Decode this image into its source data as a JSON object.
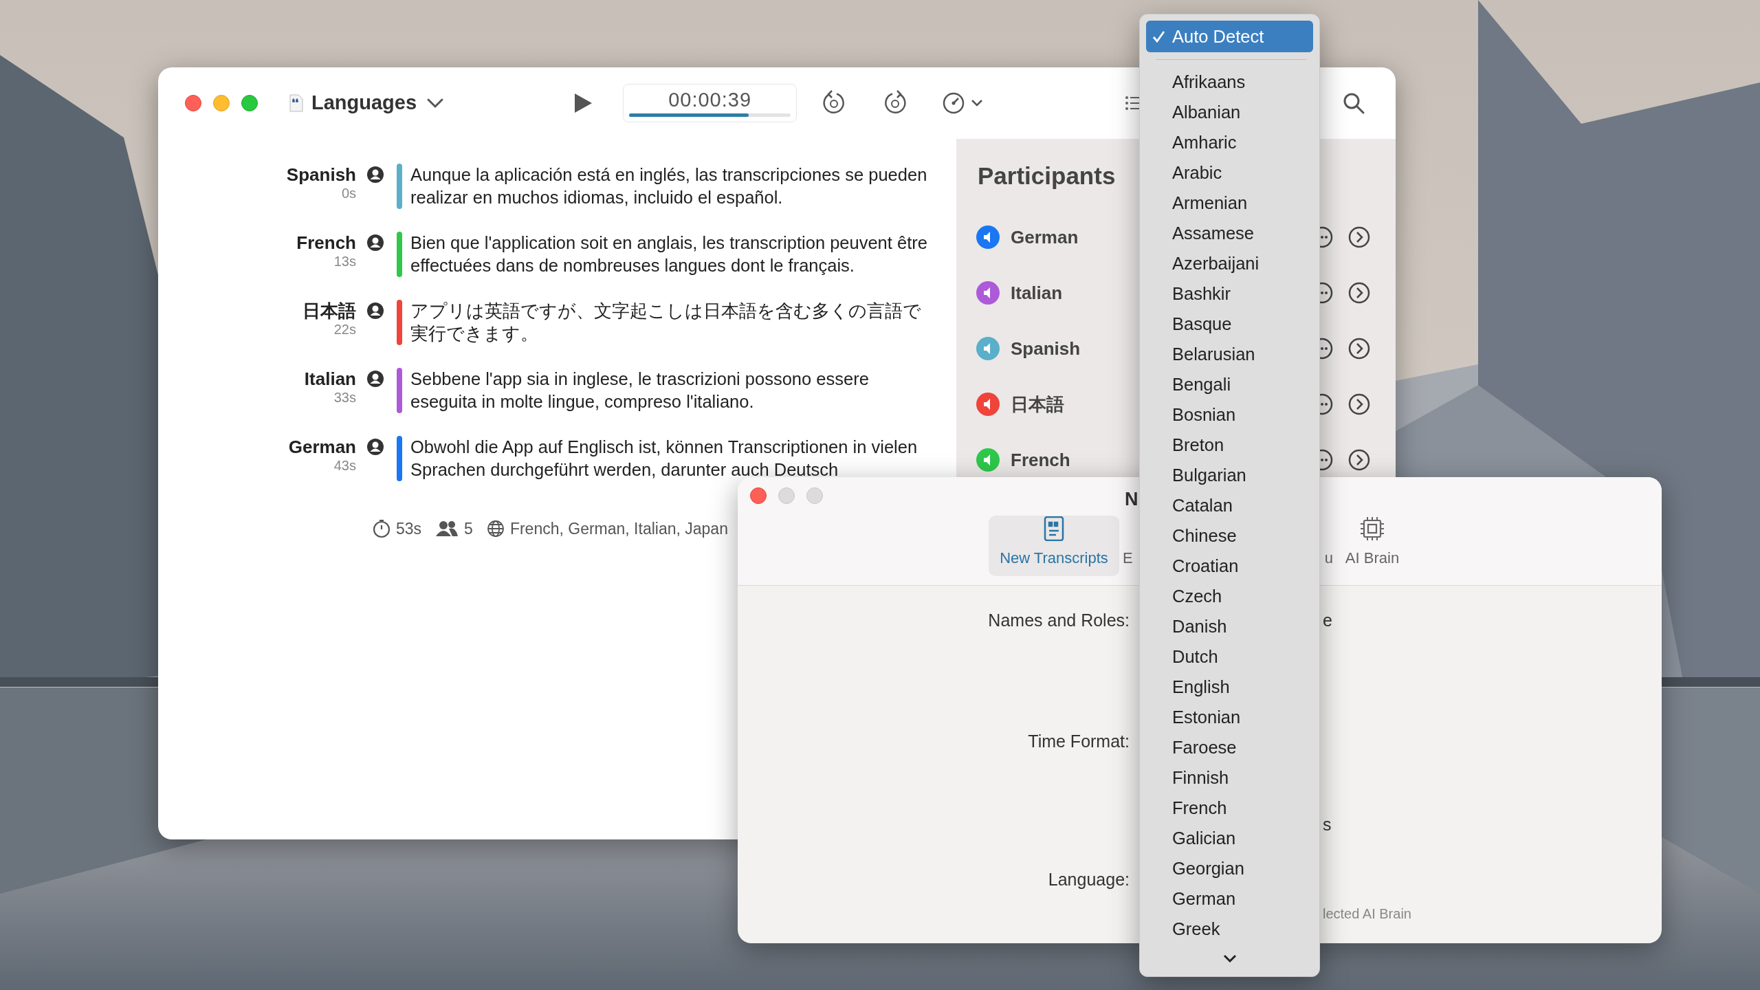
{
  "main_window": {
    "title": "Languages",
    "timer": "00:00:39",
    "progress": {
      "level": 0.74
    },
    "transcript": [
      {
        "speaker": "Spanish",
        "time": "0s",
        "color": "#5aafca",
        "text": "Aunque la aplicación está en inglés, las transcripciones se pueden realizar en muchos idiomas, incluido el español."
      },
      {
        "speaker": "French",
        "time": "13s",
        "color": "#2fc84b",
        "text": "Bien que l'application soit en anglais, les transcription peuvent être effectuées dans de nombreuses langues dont le français."
      },
      {
        "speaker": "日本語",
        "time": "22s",
        "color": "#f0433a",
        "text": "アプリは英語ですが、文字起こしは日本語を含む多くの言語で実行できます。"
      },
      {
        "speaker": "Italian",
        "time": "33s",
        "color": "#ad5ad9",
        "text": "Sebbene l'app sia in inglese, le trascrizioni possono essere eseguita in molte lingue, compreso l'italiano."
      },
      {
        "speaker": "German",
        "time": "43s",
        "color": "#1a76f2",
        "text": "Obwohl die App auf Englisch ist, können Transcriptionen in vielen Sprachen durchgeführt werden, darunter auch Deutsch"
      }
    ],
    "footer": {
      "duration": "53s",
      "participants": "5",
      "languages": "French, German, Italian, Japan"
    },
    "participants": {
      "title": "Participants",
      "items": [
        {
          "name": "German",
          "color": "#1a76f2"
        },
        {
          "name": "Italian",
          "color": "#ad5ad9"
        },
        {
          "name": "Spanish",
          "color": "#5aafca"
        },
        {
          "name": "日本語",
          "color": "#f0433a"
        },
        {
          "name": "French",
          "color": "#2fc84b"
        }
      ]
    }
  },
  "preferences_window": {
    "title": "N",
    "tabs": [
      {
        "label": "New Transcripts",
        "selected": true,
        "kind": "transcripts"
      },
      {
        "label": "E",
        "selected": false,
        "kind": "hidden"
      },
      {
        "label": "u",
        "selected": false,
        "kind": "hidden"
      },
      {
        "label": "AI Brain",
        "selected": false,
        "kind": "brain"
      }
    ],
    "form_rows": [
      {
        "label": "Names and Roles:",
        "value": "e"
      },
      {
        "label": "Time Format:"
      },
      {
        "value": "s"
      },
      {
        "label": "Language:"
      },
      {
        "note": "lected AI Brain"
      }
    ]
  },
  "language_menu": {
    "items": [
      {
        "label": "Auto Detect",
        "selected": true
      },
      {
        "label": "Afrikaans",
        "selected": false
      },
      {
        "label": "Albanian",
        "selected": false
      },
      {
        "label": "Amharic",
        "selected": false
      },
      {
        "label": "Arabic",
        "selected": false
      },
      {
        "label": "Armenian",
        "selected": false
      },
      {
        "label": "Assamese",
        "selected": false
      },
      {
        "label": "Azerbaijani",
        "selected": false
      },
      {
        "label": "Bashkir",
        "selected": false
      },
      {
        "label": "Basque",
        "selected": false
      },
      {
        "label": "Belarusian",
        "selected": false
      },
      {
        "label": "Bengali",
        "selected": false
      },
      {
        "label": "Bosnian",
        "selected": false
      },
      {
        "label": "Breton",
        "selected": false
      },
      {
        "label": "Bulgarian",
        "selected": false
      },
      {
        "label": "Catalan",
        "selected": false
      },
      {
        "label": "Chinese",
        "selected": false
      },
      {
        "label": "Croatian",
        "selected": false
      },
      {
        "label": "Czech",
        "selected": false
      },
      {
        "label": "Danish",
        "selected": false
      },
      {
        "label": "Dutch",
        "selected": false
      },
      {
        "label": "English",
        "selected": false
      },
      {
        "label": "Estonian",
        "selected": false
      },
      {
        "label": "Faroese",
        "selected": false
      },
      {
        "label": "Finnish",
        "selected": false
      },
      {
        "label": "French",
        "selected": false
      },
      {
        "label": "Galician",
        "selected": false
      },
      {
        "label": "Georgian",
        "selected": false
      },
      {
        "label": "German",
        "selected": false
      },
      {
        "label": "Greek",
        "selected": false
      }
    ]
  }
}
